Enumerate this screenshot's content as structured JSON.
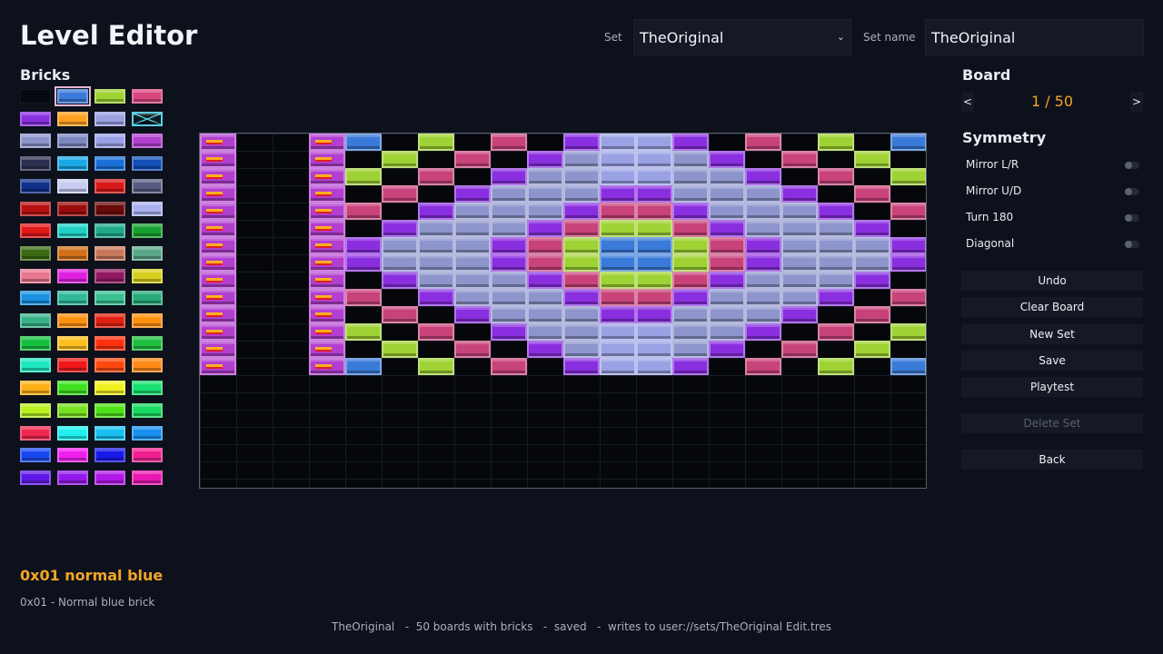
{
  "header": {
    "title": "Level Editor",
    "set_label": "Set",
    "set_value": "TheOriginal",
    "set_name_label": "Set name",
    "set_name_value": "TheOriginal"
  },
  "bricks_panel": {
    "label": "Bricks",
    "selected_index": 1,
    "palette": [
      "empty",
      "#3a7ad8",
      "#9fd234",
      "#d9477e",
      "#8a2fe0",
      "#ffa020",
      "#9aa0e0",
      "xbrick",
      "#8e95cc",
      "#7d86c0",
      "#9aa0e6",
      "#b23fd0",
      "#2c3050",
      "#1aa8e8",
      "#1a70d8",
      "#1250b8",
      "#10308a",
      "#c8ccf0",
      "#d81818",
      "#565c80",
      "#b81010",
      "#9a0c0c",
      "#6a0a0a",
      "#aab0f0",
      "#e01818",
      "#20d0c8",
      "#20a88a",
      "#18a030",
      "#3c6a12",
      "#d07018",
      "#c8785a",
      "#5aa88a",
      "#e87890",
      "#e020e0",
      "#901860",
      "#d8d020",
      "#1a90e0",
      "#30b898",
      "#38c090",
      "#28a878",
      "#38b088",
      "#ff9010",
      "#e02010",
      "#ff9010",
      "#18c040",
      "#ffc020",
      "#ff3010",
      "#20c040",
      "#20e8c0",
      "#f01818",
      "#ff4810",
      "#ff8a18",
      "#ffb018",
      "#40e020",
      "#f0f020",
      "#18e070",
      "#b8f020",
      "#78e020",
      "#50e018",
      "#18d860",
      "#f02850",
      "#20f0f0",
      "#18c0f0",
      "#1890f0",
      "#1848f0",
      "#f020f0",
      "#1818e8",
      "#f02090",
      "#6018e8",
      "#9018e8",
      "#b018e8",
      "#e818b0"
    ]
  },
  "board_panel": {
    "label": "Board",
    "prev": "<",
    "next": ">",
    "count": "1 / 50"
  },
  "symmetry": {
    "label": "Symmetry",
    "options": [
      {
        "label": "Mirror L/R",
        "enabled": false
      },
      {
        "label": "Mirror U/D",
        "enabled": false
      },
      {
        "label": "Turn 180",
        "enabled": false
      },
      {
        "label": "Diagonal",
        "enabled": false
      }
    ]
  },
  "actions": {
    "undo": "Undo",
    "clear_board": "Clear Board",
    "new_set": "New Set",
    "save": "Save",
    "playtest": "Playtest",
    "delete_set": "Delete Set",
    "back": "Back"
  },
  "selection": {
    "name": "0x01 normal blue",
    "description": "0x01 - Normal blue brick"
  },
  "status": [
    "TheOriginal",
    "50 boards with bricks",
    "saved",
    "writes to user://sets/TheOriginal Edit.tres"
  ],
  "board": {
    "columns": 20,
    "rows": 20,
    "legend": {
      "P": "#b23fd0",
      "B": "#3a7ad8",
      "G": "#9fd234",
      "R": "#c8437a",
      "V": "#8a2fe0",
      "L": "#8e95cc",
      "C": "#9aa2e4"
    },
    "grid": [
      "P..PB.G.R.VCCV.R.G.B",
      "P..P.G.R.VLCCLV.R.G.",
      "P..PG.R.VLLCCLLV.R.G",
      "P..P.R.VLLLVVLLLV.R.",
      "P..PR.VLLLVRRVLLLV.R",
      "P..P.VLLLVRGGRVLLLV.",
      "P..PVLLLVRGBBGRVLLLV",
      "P..PVLLLVRGBBGRVLLLV",
      "P..P.VLLLVRGGRVLLLV.",
      "P..PR.VLLLVRRVLLLV.R",
      "P..P.R.VLLLVVLLLV.R.",
      "P..PG.R.VLLCCLLV.R.G",
      "P..P.G.R.VLCCLV.R.G.",
      "P..PB.G.R.VCCV.R.G.B",
      "....................",
      "....................",
      "....................",
      "....................",
      "....................",
      "...................."
    ]
  }
}
